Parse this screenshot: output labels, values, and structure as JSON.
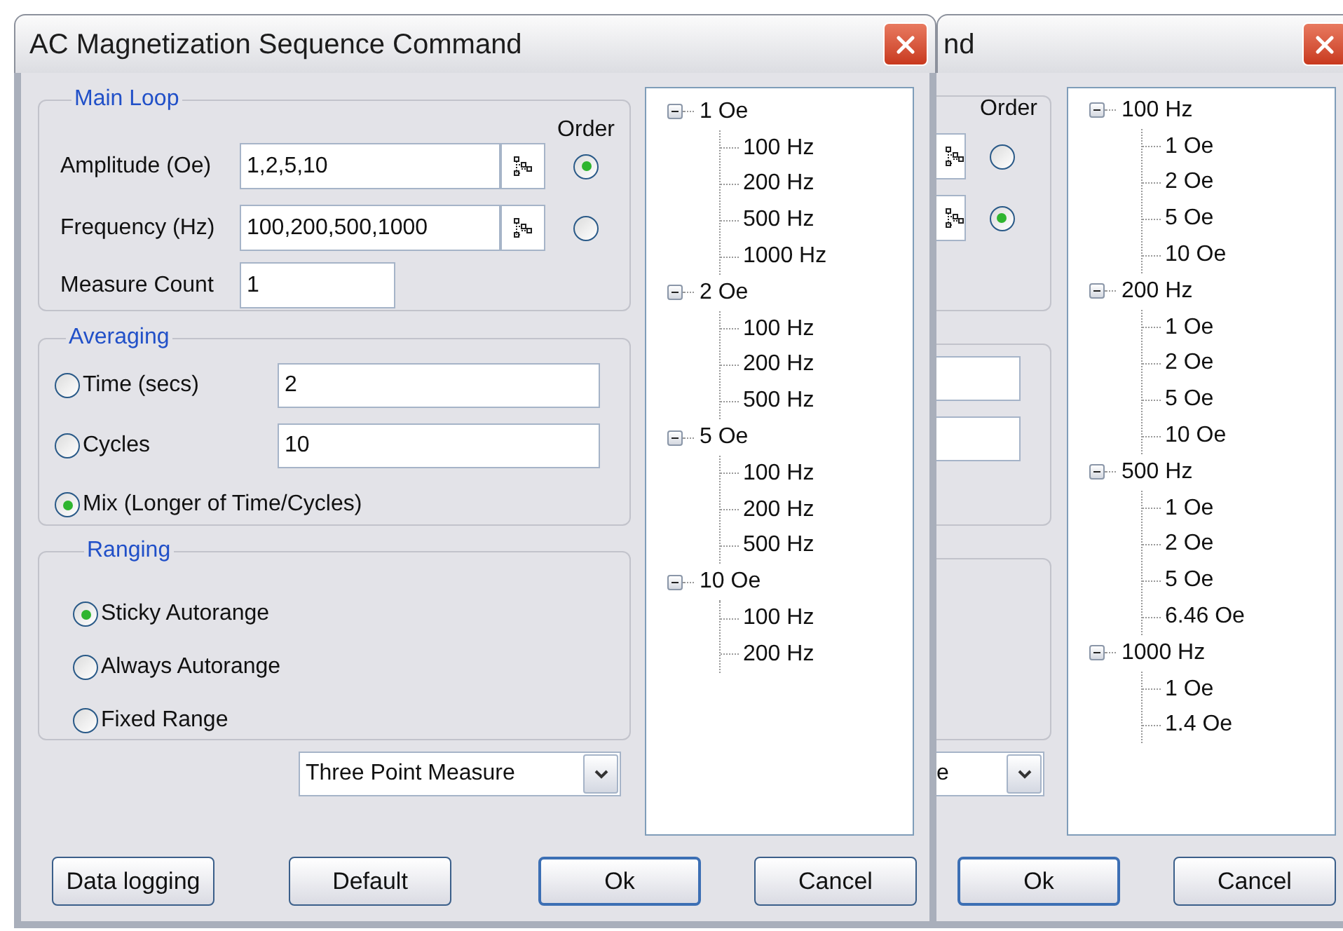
{
  "front_dialog": {
    "title": "AC Magnetization Sequence Command",
    "main_loop": {
      "label": "Main Loop",
      "order_label": "Order",
      "rows": [
        {
          "kind": "list",
          "label": "Amplitude (Oe)",
          "value": "1,2,5,10",
          "selected": true
        },
        {
          "kind": "list",
          "label": "Frequency (Hz)",
          "value": "100,200,500,1000",
          "selected": false
        },
        {
          "kind": "count",
          "label": "Measure Count",
          "value": "1"
        }
      ]
    },
    "averaging": {
      "label": "Averaging",
      "options": [
        {
          "label": "Time (secs)",
          "selected": false,
          "value": "2"
        },
        {
          "label": "Cycles",
          "selected": false,
          "value": "10"
        },
        {
          "label": "Mix (Longer of Time/Cycles)",
          "selected": true
        }
      ]
    },
    "ranging": {
      "label": "Ranging",
      "options": [
        {
          "label": "Sticky Autorange",
          "selected": true
        },
        {
          "label": "Always Autorange",
          "selected": false
        },
        {
          "label": "Fixed Range",
          "selected": false
        }
      ]
    },
    "measure_mode": "Three Point Measure",
    "tree": [
      {
        "label": "1 Oe",
        "expanded": true,
        "children": [
          {
            "label": "100 Hz"
          },
          {
            "label": "200 Hz"
          },
          {
            "label": "500 Hz"
          },
          {
            "label": "1000 Hz"
          }
        ]
      },
      {
        "label": "2 Oe",
        "expanded": true,
        "children": [
          {
            "label": "100 Hz"
          },
          {
            "label": "200 Hz"
          },
          {
            "label": "500 Hz"
          }
        ]
      },
      {
        "label": "5 Oe",
        "expanded": true,
        "children": [
          {
            "label": "100 Hz"
          },
          {
            "label": "200 Hz"
          },
          {
            "label": "500 Hz"
          }
        ]
      },
      {
        "label": "10 Oe",
        "expanded": true,
        "children": [
          {
            "label": "100 Hz"
          },
          {
            "label": "200 Hz"
          }
        ]
      }
    ],
    "buttons": [
      {
        "label": "Data logging",
        "default": false
      },
      {
        "label": "Default",
        "default": false
      },
      {
        "label": "Ok",
        "default": true
      },
      {
        "label": "Cancel",
        "default": false
      }
    ]
  },
  "back_dialog": {
    "title": "nd",
    "order_label": "Order",
    "order": [
      {
        "selected": false
      },
      {
        "selected": true
      }
    ],
    "measure_mode": "e",
    "tree": [
      {
        "label": "100 Hz",
        "expanded": true,
        "children": [
          {
            "label": "1 Oe"
          },
          {
            "label": "2 Oe"
          },
          {
            "label": "5 Oe"
          },
          {
            "label": "10 Oe"
          }
        ]
      },
      {
        "label": "200 Hz",
        "expanded": true,
        "children": [
          {
            "label": "1 Oe"
          },
          {
            "label": "2 Oe"
          },
          {
            "label": "5 Oe"
          },
          {
            "label": "10 Oe"
          }
        ]
      },
      {
        "label": "500 Hz",
        "expanded": true,
        "children": [
          {
            "label": "1 Oe"
          },
          {
            "label": "2 Oe"
          },
          {
            "label": "5 Oe"
          },
          {
            "label": "6.46 Oe"
          }
        ]
      },
      {
        "label": "1000 Hz",
        "expanded": true,
        "children": [
          {
            "label": "1 Oe"
          },
          {
            "label": "1.4 Oe"
          }
        ]
      }
    ],
    "buttons": [
      {
        "label": "Ok",
        "default": true
      },
      {
        "label": "Cancel",
        "default": false
      }
    ]
  }
}
